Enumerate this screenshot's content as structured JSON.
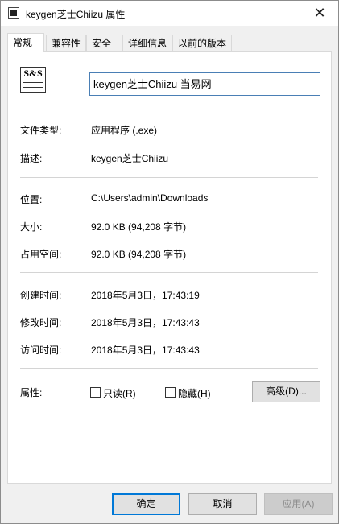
{
  "window": {
    "title": "keygen芝士Chiizu 属性",
    "close_glyph": "✕"
  },
  "tabs": [
    {
      "label": "常规",
      "active": true
    },
    {
      "label": "兼容性"
    },
    {
      "label": "安全"
    },
    {
      "label": "详细信息"
    },
    {
      "label": "以前的版本"
    }
  ],
  "general": {
    "icon_text": "S&S",
    "file_name": "keygen芝士Chiizu  当易网",
    "rows": [
      {
        "label": "文件类型:",
        "value": "应用程序 (.exe)"
      },
      {
        "label": "描述:",
        "value": "keygen芝士Chiizu"
      },
      {
        "label": "位置:",
        "value": "C:\\Users\\admin\\Downloads"
      },
      {
        "label": "大小:",
        "value": "92.0 KB (94,208 字节)"
      },
      {
        "label": "占用空间:",
        "value": "92.0 KB (94,208 字节)"
      },
      {
        "label": "创建时间:",
        "value": "2018年5月3日，17:43:19"
      },
      {
        "label": "修改时间:",
        "value": "2018年5月3日，17:43:43"
      },
      {
        "label": "访问时间:",
        "value": "2018年5月3日，17:43:43"
      }
    ],
    "attributes_label": "属性:",
    "readonly_label": "只读(R)",
    "hidden_label": "隐藏(H)",
    "advanced_label": "高级(D)..."
  },
  "footer": {
    "ok_label": "确定",
    "cancel_label": "取消",
    "apply_label": "应用(A)"
  }
}
